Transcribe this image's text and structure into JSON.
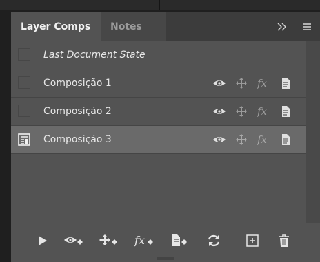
{
  "tabs": [
    {
      "label": "Layer Comps",
      "active": true
    },
    {
      "label": "Notes",
      "active": false
    }
  ],
  "tab_controls": {
    "collapse_icon": "double-chevron-right-icon",
    "menu_icon": "hamburger-menu-icon"
  },
  "rows": [
    {
      "name": "Last Document State",
      "italic": true,
      "selected": false,
      "show_icons": false
    },
    {
      "name": "Composição 1",
      "italic": false,
      "selected": false,
      "show_icons": true
    },
    {
      "name": "Composição 2",
      "italic": false,
      "selected": false,
      "show_icons": true
    },
    {
      "name": "Composição 3",
      "italic": false,
      "selected": true,
      "show_icons": true
    }
  ],
  "row_icons": [
    "eye-icon",
    "move-icon",
    "fx-icon",
    "document-icon"
  ],
  "bottom_buttons": [
    "play-icon",
    "visibility-toggle-icon",
    "position-toggle-icon",
    "appearance-toggle-icon",
    "doc-state-icon",
    "refresh-icon",
    "new-comp-icon",
    "trash-icon"
  ],
  "colors": {
    "panel": "#535353",
    "tabbar": "#3c3c3c",
    "selected_row": "#6a6a6a",
    "icon": "#d8d8d8"
  }
}
